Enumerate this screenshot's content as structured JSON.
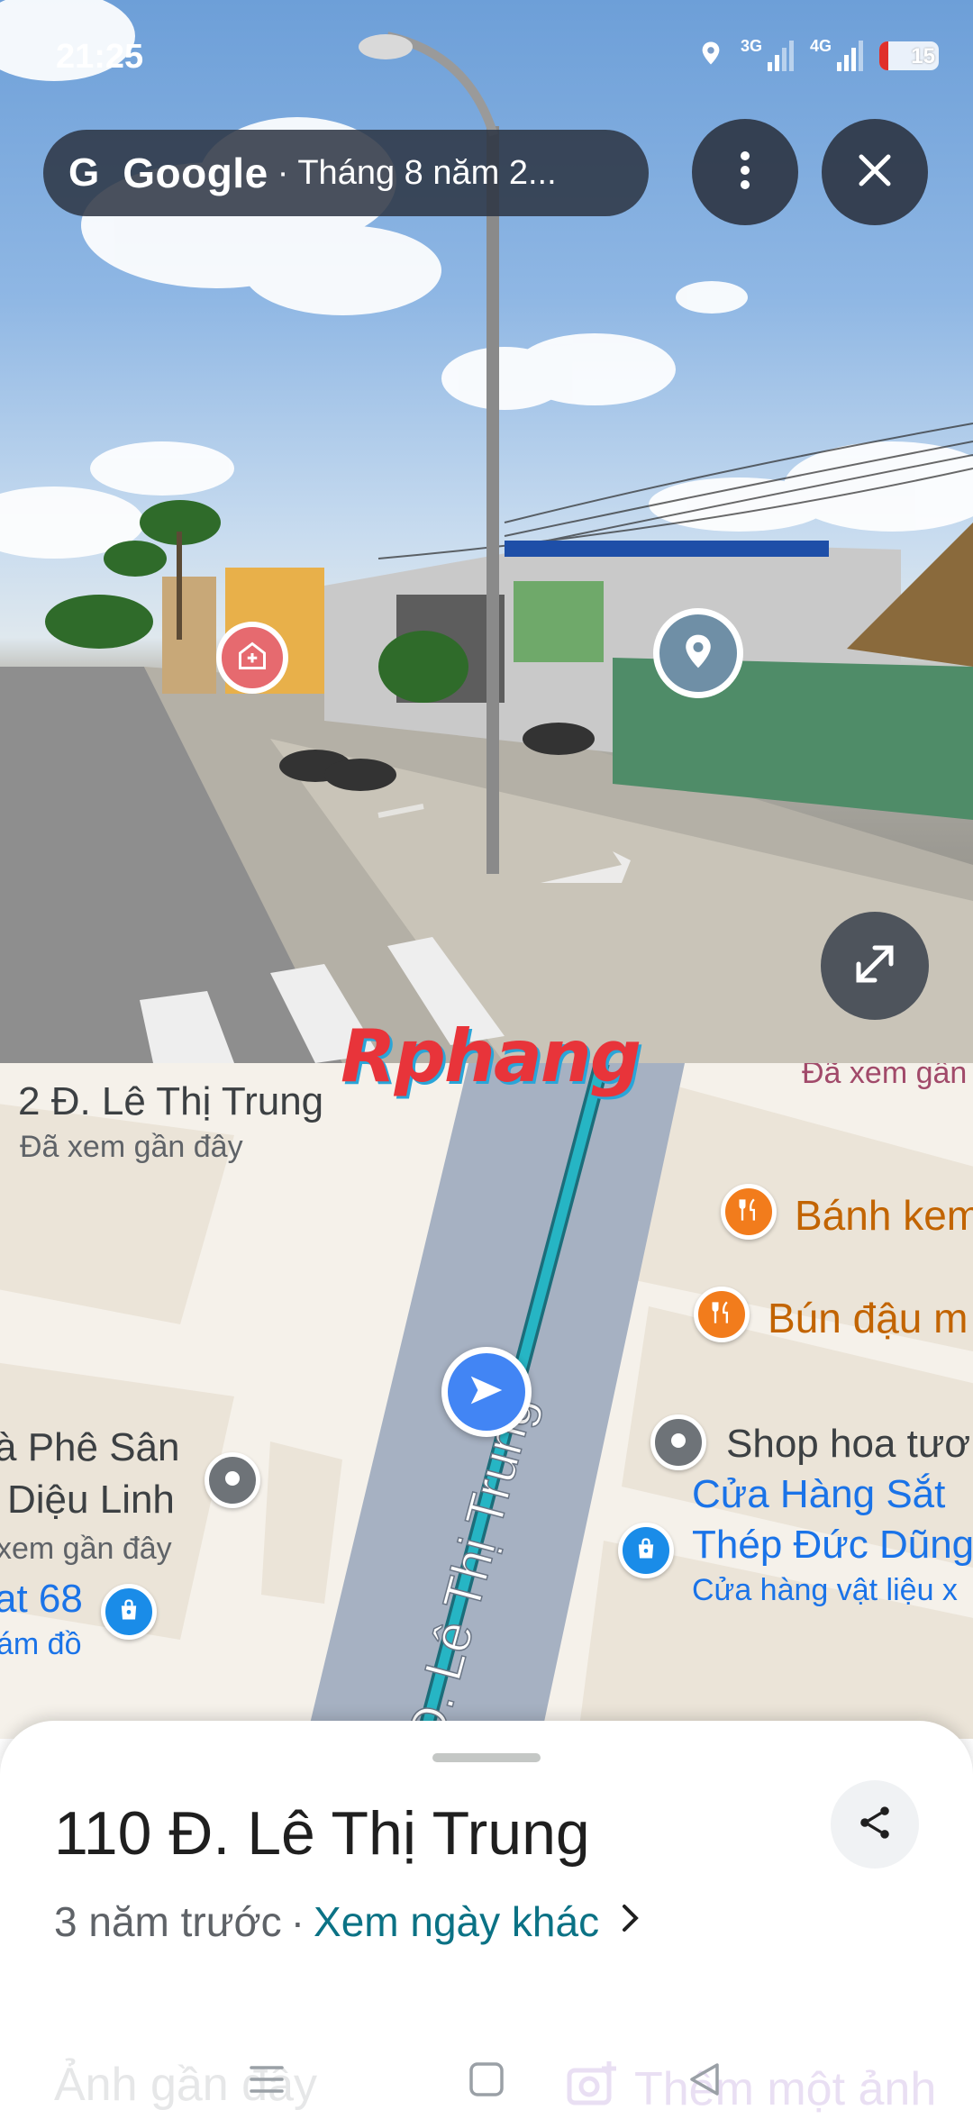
{
  "status_bar": {
    "time": "21:25",
    "network_1": "3G",
    "network_2": "4G",
    "battery": "15"
  },
  "top_bar": {
    "brand": "Google",
    "separator": "·",
    "date": "Tháng 8 năm 2...",
    "more_icon": "more-vert-icon",
    "close_icon": "close-icon"
  },
  "watermark": "Rphang",
  "map": {
    "street_name": "Đ. Lê Thị Trung",
    "labels": {
      "place_top": "2 Đ. Lê Thị Trung",
      "place_top_sub": "Đã xem gần đây",
      "top_right_cut": "Đã xem gần",
      "banh_kem": "Bánh kem",
      "bun_dau": "Bún đậu m",
      "ca_phe_1": "à Phê Sân",
      "ca_phe_2": "Diệu Linh",
      "ca_phe_sub": "xem gần đây",
      "shop_hoa": "Shop hoa tươ",
      "shop_68_1": "at 68",
      "shop_68_2": "ám đồ",
      "cua_hang_1": "Cửa Hàng Sắt",
      "cua_hang_2": "Thép Đức Dũng",
      "cua_hang_sub": "Cửa hàng vật liệu x"
    }
  },
  "sheet": {
    "title": "110 Đ. Lê Thị Trung",
    "age": "3 năm trước",
    "separator": "·",
    "link": "Xem ngày khác",
    "faded_left": "Ảnh gần đây",
    "faded_right": "Thêm một ảnh"
  },
  "colors": {
    "accent_link": "#0b7285",
    "route": "#26b5c4",
    "nav_marker": "#4285f4",
    "pin_orange": "#f27c1c",
    "pin_blue": "#1a8ce8",
    "pin_grey": "#6e7378"
  }
}
